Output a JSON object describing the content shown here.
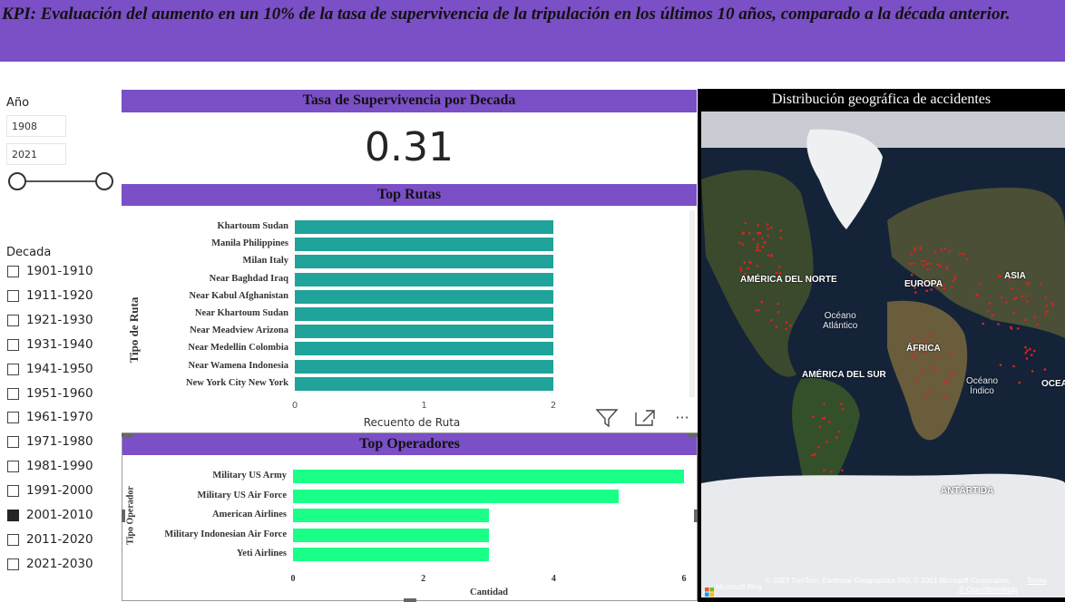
{
  "kpi_banner": "KPI: Evaluación del aumento en un 10% de la tasa de supervivencia de la tripulación en los últimos 10 años, comparado a la década anterior.",
  "year_filter": {
    "label": "Año",
    "start": "1908",
    "end": "2021"
  },
  "decade_filter": {
    "label": "Decada",
    "items": [
      {
        "label": "1901-1910",
        "checked": false
      },
      {
        "label": "1911-1920",
        "checked": false
      },
      {
        "label": "1921-1930",
        "checked": false
      },
      {
        "label": "1931-1940",
        "checked": false
      },
      {
        "label": "1941-1950",
        "checked": false
      },
      {
        "label": "1951-1960",
        "checked": false
      },
      {
        "label": "1961-1970",
        "checked": false
      },
      {
        "label": "1971-1980",
        "checked": false
      },
      {
        "label": "1981-1990",
        "checked": false
      },
      {
        "label": "1991-2000",
        "checked": false
      },
      {
        "label": "2001-2010",
        "checked": true
      },
      {
        "label": "2011-2020",
        "checked": false
      },
      {
        "label": "2021-2030",
        "checked": false
      }
    ]
  },
  "survival_card": {
    "title": "Tasa de Supervivencia por Decada",
    "value": "0.31"
  },
  "visual_toolbar": {
    "filter_icon": "filter-icon",
    "focus_icon": "focus-mode-icon",
    "more_label": "···"
  },
  "map": {
    "title": "Distribución geográfica de accidentes",
    "labels": [
      {
        "text": "AMÉRICA DEL NORTE"
      },
      {
        "text": "EUROPA"
      },
      {
        "text": "ASIA"
      },
      {
        "text": "ÁFRICA"
      },
      {
        "text": "AMÉRICA DEL SUR"
      },
      {
        "text": "OCEA"
      },
      {
        "text": "ANTÁRTIDA"
      }
    ],
    "oceans": [
      {
        "line1": "Océano",
        "line2": "Atlántico"
      },
      {
        "line1": "Océano",
        "line2": "Índico"
      }
    ],
    "bing_label": "Microsoft Bing",
    "attribution": "© 2023 TomTom, Earthstar Geographics SIO, © 2023 Microsoft Corporation,",
    "terms": "Terms",
    "osm": "© OpenStreetMap",
    "point_color": "#e02020"
  },
  "colors": {
    "accent": "#7b4fc5",
    "routes_bar": "#1fa39a",
    "operators_bar": "#19ff87"
  },
  "chart_data": [
    {
      "type": "bar",
      "orientation": "horizontal",
      "title": "Top Rutas",
      "categories": [
        "Khartoum Sudan",
        "Manila Philippines",
        "Milan Italy",
        "Near Baghdad Iraq",
        "Near Kabul Afghanistan",
        "Near Khartoum Sudan",
        "Near Meadview Arizona",
        "Near Medellin Colombia",
        "Near Wamena Indonesia",
        "New York City New York"
      ],
      "values": [
        2,
        2,
        2,
        2,
        2,
        2,
        2,
        2,
        2,
        2
      ],
      "xlabel": "Recuento de Ruta",
      "ylabel": "Tipo de Ruta",
      "xlim": [
        0,
        2
      ],
      "xticks": [
        "0",
        "1",
        "2"
      ]
    },
    {
      "type": "bar",
      "orientation": "horizontal",
      "title": "Top Operadores",
      "categories": [
        "Military US Army",
        "Military US Air Force",
        "American Airlines",
        "Military Indonesian Air Force",
        "Yeti Airlines"
      ],
      "values": [
        6,
        5,
        3,
        3,
        3
      ],
      "xlabel": "Cantidad",
      "ylabel": "Tipo Operador",
      "xlim": [
        0,
        6
      ],
      "xticks": [
        "0",
        "2",
        "4",
        "6"
      ]
    }
  ]
}
